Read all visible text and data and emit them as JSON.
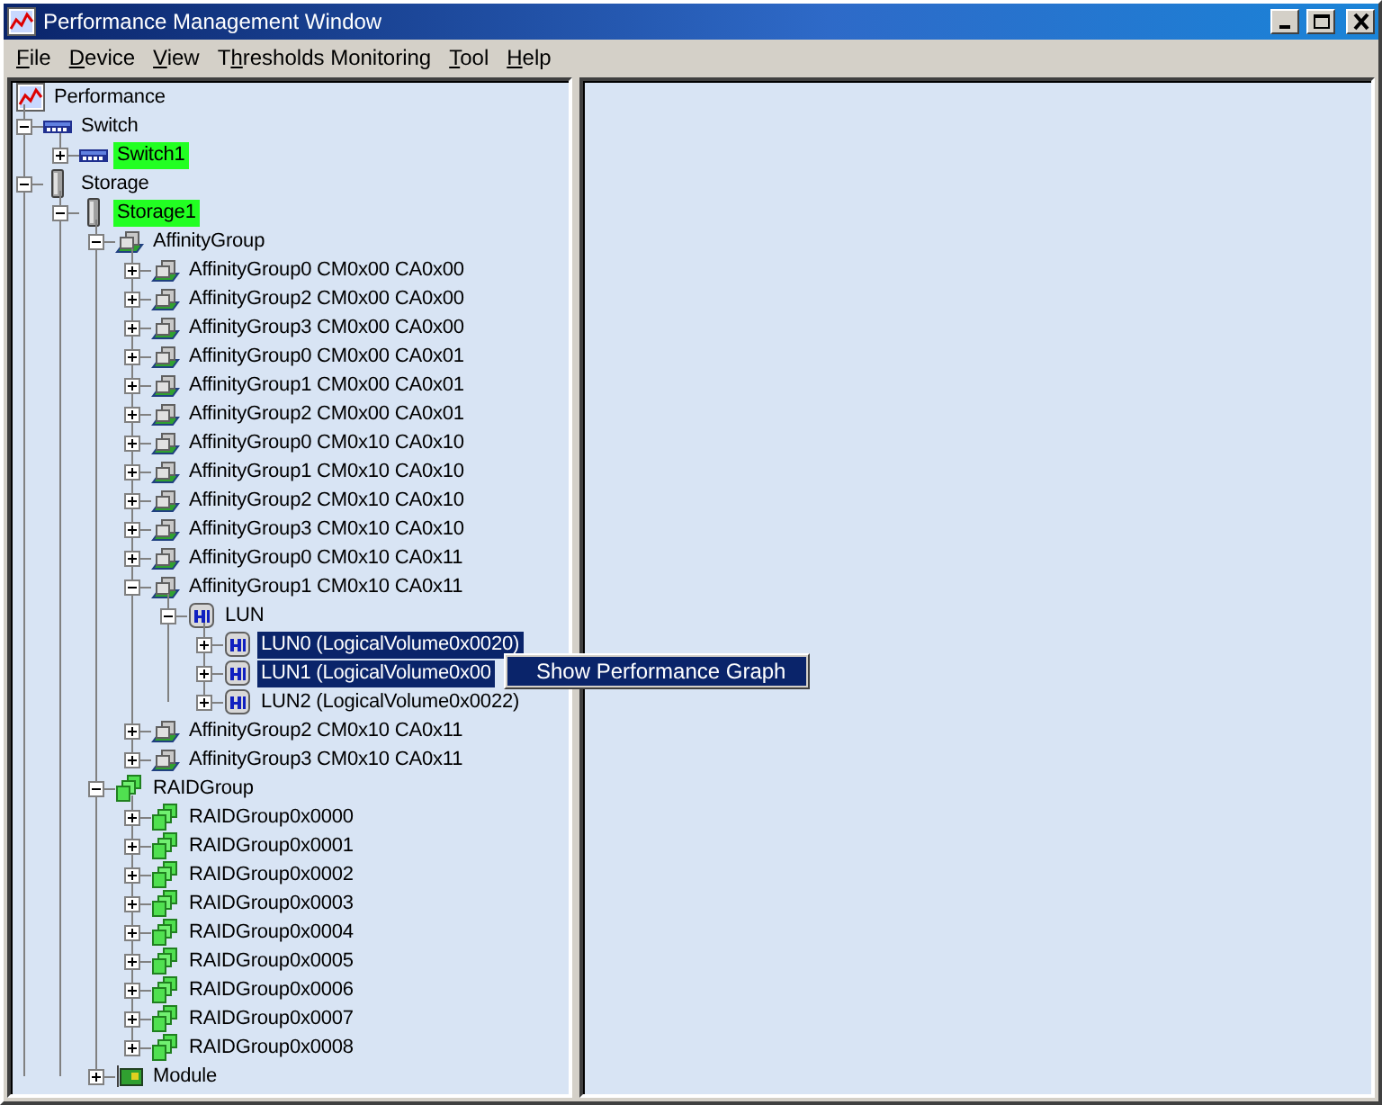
{
  "window": {
    "title": "Performance Management Window"
  },
  "menu": [
    {
      "key": "F",
      "after": "ile"
    },
    {
      "key": "D",
      "after": "evice"
    },
    {
      "key": "V",
      "after": "iew"
    },
    {
      "before": "T",
      "key": "h",
      "after": "resholds Monitoring"
    },
    {
      "key": "T",
      "after": "ool"
    },
    {
      "key": "H",
      "after": "elp"
    }
  ],
  "tree": {
    "label": "Performance",
    "kind": "performance",
    "children": [
      {
        "label": "Switch",
        "kind": "switch",
        "expanded": true,
        "children": [
          {
            "label": "Switch1",
            "kind": "switch",
            "expanded": false,
            "highlighted": true
          }
        ]
      },
      {
        "label": "Storage",
        "kind": "storage",
        "expanded": true,
        "children": [
          {
            "label": "Storage1",
            "kind": "storage",
            "expanded": true,
            "highlighted": true,
            "children": [
              {
                "label": "AffinityGroup",
                "kind": "affinity",
                "expanded": true,
                "children": [
                  {
                    "label": "AffinityGroup0 CM0x00 CA0x00",
                    "kind": "affinity",
                    "expanded": false
                  },
                  {
                    "label": "AffinityGroup2 CM0x00 CA0x00",
                    "kind": "affinity",
                    "expanded": false
                  },
                  {
                    "label": "AffinityGroup3 CM0x00 CA0x00",
                    "kind": "affinity",
                    "expanded": false
                  },
                  {
                    "label": "AffinityGroup0 CM0x00 CA0x01",
                    "kind": "affinity",
                    "expanded": false
                  },
                  {
                    "label": "AffinityGroup1 CM0x00 CA0x01",
                    "kind": "affinity",
                    "expanded": false
                  },
                  {
                    "label": "AffinityGroup2 CM0x00 CA0x01",
                    "kind": "affinity",
                    "expanded": false
                  },
                  {
                    "label": "AffinityGroup0 CM0x10 CA0x10",
                    "kind": "affinity",
                    "expanded": false
                  },
                  {
                    "label": "AffinityGroup1 CM0x10 CA0x10",
                    "kind": "affinity",
                    "expanded": false
                  },
                  {
                    "label": "AffinityGroup2 CM0x10 CA0x10",
                    "kind": "affinity",
                    "expanded": false
                  },
                  {
                    "label": "AffinityGroup3 CM0x10 CA0x10",
                    "kind": "affinity",
                    "expanded": false
                  },
                  {
                    "label": "AffinityGroup0 CM0x10 CA0x11",
                    "kind": "affinity",
                    "expanded": false
                  },
                  {
                    "label": "AffinityGroup1 CM0x10 CA0x11",
                    "kind": "affinity",
                    "expanded": true,
                    "children": [
                      {
                        "label": "LUN",
                        "kind": "lun",
                        "expanded": true,
                        "children": [
                          {
                            "label": "LUN0 (LogicalVolume0x0020)",
                            "kind": "lun",
                            "expanded": false,
                            "selected": true
                          },
                          {
                            "label": "LUN1 (LogicalVolume0x00",
                            "kind": "lun",
                            "expanded": false,
                            "selected": true
                          },
                          {
                            "label": "LUN2 (LogicalVolume0x0022)",
                            "kind": "lun",
                            "expanded": false,
                            "selected": false
                          }
                        ]
                      }
                    ]
                  },
                  {
                    "label": "AffinityGroup2 CM0x10 CA0x11",
                    "kind": "affinity",
                    "expanded": false
                  },
                  {
                    "label": "AffinityGroup3 CM0x10 CA0x11",
                    "kind": "affinity",
                    "expanded": false
                  }
                ]
              },
              {
                "label": "RAIDGroup",
                "kind": "raid",
                "expanded": true,
                "children": [
                  {
                    "label": "RAIDGroup0x0000",
                    "kind": "raid",
                    "expanded": false
                  },
                  {
                    "label": "RAIDGroup0x0001",
                    "kind": "raid",
                    "expanded": false
                  },
                  {
                    "label": "RAIDGroup0x0002",
                    "kind": "raid",
                    "expanded": false
                  },
                  {
                    "label": "RAIDGroup0x0003",
                    "kind": "raid",
                    "expanded": false
                  },
                  {
                    "label": "RAIDGroup0x0004",
                    "kind": "raid",
                    "expanded": false
                  },
                  {
                    "label": "RAIDGroup0x0005",
                    "kind": "raid",
                    "expanded": false
                  },
                  {
                    "label": "RAIDGroup0x0006",
                    "kind": "raid",
                    "expanded": false
                  },
                  {
                    "label": "RAIDGroup0x0007",
                    "kind": "raid",
                    "expanded": false
                  },
                  {
                    "label": "RAIDGroup0x0008",
                    "kind": "raid",
                    "expanded": false
                  }
                ]
              },
              {
                "label": "Module",
                "kind": "module",
                "expanded": false
              }
            ]
          }
        ]
      }
    ]
  },
  "context_menu": {
    "items": [
      {
        "label": "Show Performance Graph",
        "selected": true
      }
    ]
  }
}
